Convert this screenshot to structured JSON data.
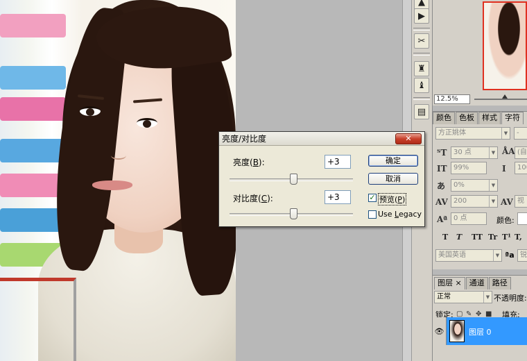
{
  "dialog": {
    "title": "亮度/对比度",
    "close_label": "✕",
    "brightness": {
      "label_prefix": "亮度(",
      "mnemonic": "B",
      "label_suffix": "):",
      "value": "+3"
    },
    "contrast": {
      "label_prefix": "对比度(",
      "mnemonic": "C",
      "label_suffix": "):",
      "value": "+3"
    },
    "ok_label": "确定",
    "cancel_label": "取消",
    "preview": {
      "label_prefix": "预览(",
      "mnemonic": "P",
      "label_suffix": ")",
      "checked": true
    },
    "legacy": {
      "label_prefix": "Use ",
      "mnemonic": "L",
      "label_suffix": "egacy",
      "checked": false
    }
  },
  "navigator": {
    "zoom": "12.5%"
  },
  "character_panel": {
    "tabs": [
      "颜色",
      "色板",
      "样式",
      "字符"
    ],
    "font_family": "方正姚体",
    "font_style": "-",
    "font_size": "30 点",
    "leading": "(自",
    "vertical_scale": "99%",
    "horizontal_scale": "100",
    "tsume": "0%",
    "tracking": "200",
    "kerning": "视",
    "baseline_shift": "0 点",
    "color_label": "颜色:",
    "language": "美国英语",
    "aa_label": "a",
    "aa_value": "锐",
    "style_buttons": [
      "T",
      "T",
      "TT",
      "Tr",
      "T¹",
      "T,"
    ]
  },
  "layers_panel": {
    "tabs": [
      "图层",
      "通道",
      "路径"
    ],
    "tab_close": "×",
    "blend_mode": "正常",
    "opacity_label": "不透明度:",
    "lock_label": "锁定:",
    "fill_label": "填充:",
    "layer_name": "图层 0"
  },
  "colors": {
    "selection": "#3399ff",
    "panel_bg": "#d4d0c8",
    "dialog_bg": "#ece9d8",
    "nav_frame": "#e03020"
  }
}
